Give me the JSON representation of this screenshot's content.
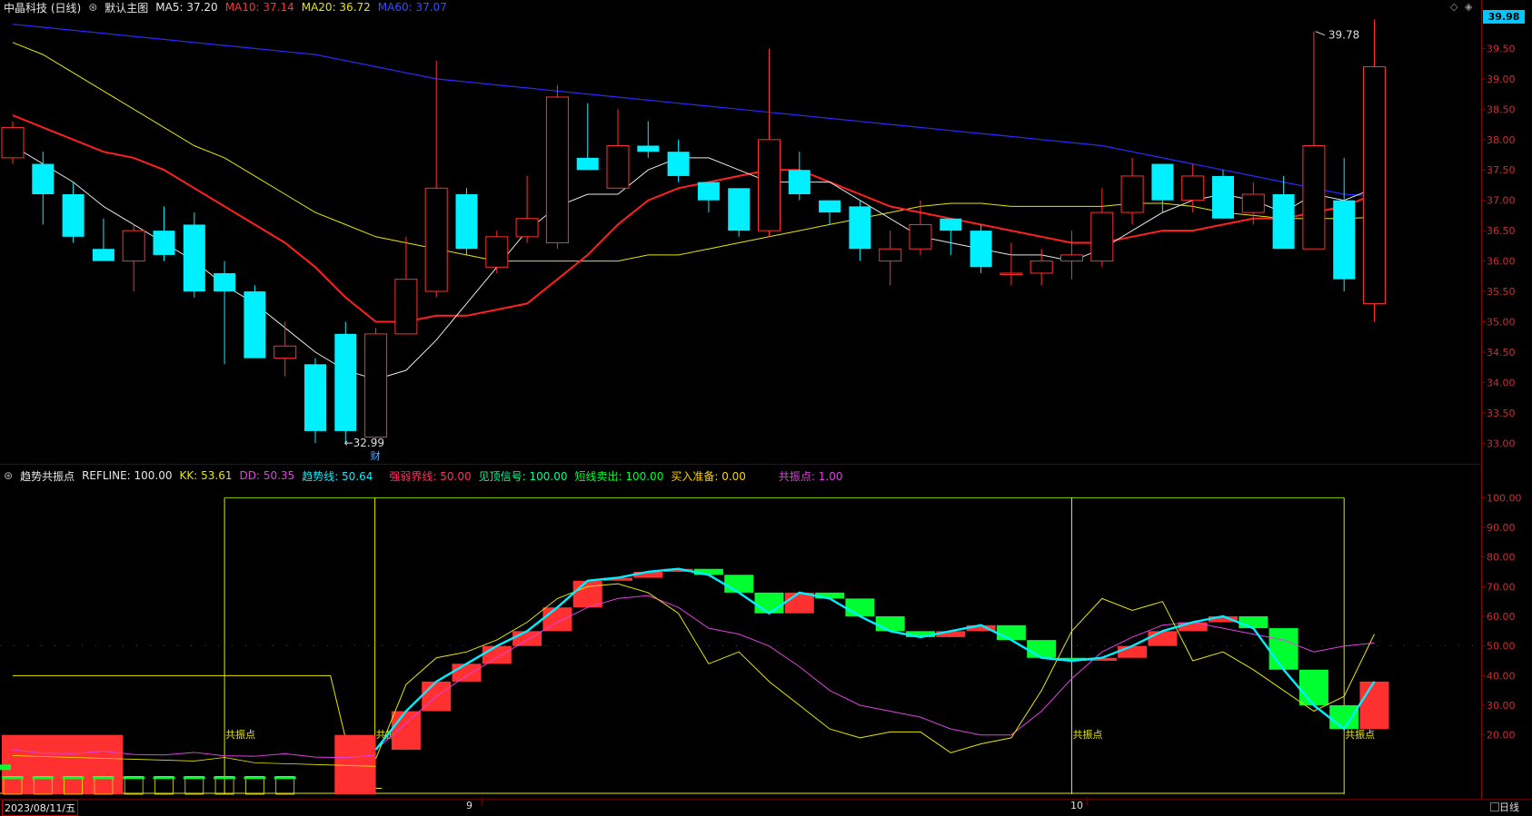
{
  "main": {
    "title": "中晶科技 (日线)",
    "template": "默认主图",
    "ma5_label": "MA5: 37.20",
    "ma10_label": "MA10: 37.14",
    "ma20_label": "MA20: 36.72",
    "ma60_label": "MA60: 37.07",
    "current_price": "39.98",
    "high_label": "39.78",
    "low_label": "32.99",
    "event_marker": "财",
    "axis_ticks": [
      "39.50",
      "39.00",
      "38.50",
      "38.00",
      "37.50",
      "37.00",
      "36.50",
      "36.00",
      "35.50",
      "35.00",
      "34.50",
      "34.00",
      "33.50",
      "33.00"
    ]
  },
  "indicator": {
    "name": "趋势共振点",
    "refline": "REFLINE: 100.00",
    "kk": "KK: 53.61",
    "dd": "DD: 50.35",
    "trend": "趋势线: 50.64",
    "strong_weak": "强弱界线: 50.00",
    "top_signal": "见顶信号: 100.00",
    "short_sell": "短线卖出: 100.00",
    "buy_ready": "买入准备: 0.00",
    "resonance": "共振点: 1.00",
    "resonance_tag": "共振点",
    "axis_ticks": [
      "100.00",
      "90.00",
      "80.00",
      "70.00",
      "60.00",
      "50.00",
      "40.00",
      "30.00",
      "20.00"
    ]
  },
  "timeline": {
    "start_date": "2023/08/11/五",
    "month_9": "9",
    "month_10": "10",
    "period_tab": "日线"
  },
  "colors": {
    "up": "#ff3030",
    "down": "#00f0ff",
    "ma5": "#e8e8e8",
    "ma10": "#ff2020",
    "ma20": "#e6e600",
    "ma60": "#2a2aff",
    "green_block": "#00ff30",
    "magenta": "#e040e0"
  },
  "chart_data": [
    {
      "type": "candlestick",
      "series_name": "中晶科技 (日线)",
      "ylim": [
        32.75,
        40.0
      ],
      "candles": [
        [
          37.7,
          38.2,
          38.3,
          37.6
        ],
        [
          37.6,
          37.1,
          37.8,
          36.6
        ],
        [
          37.1,
          36.4,
          37.3,
          36.3
        ],
        [
          36.2,
          36.0,
          36.7,
          36.0
        ],
        [
          36.0,
          36.5,
          36.6,
          35.5
        ],
        [
          36.5,
          36.1,
          36.9,
          36.0
        ],
        [
          36.6,
          35.5,
          36.8,
          35.4
        ],
        [
          35.8,
          35.5,
          36.0,
          34.3
        ],
        [
          35.5,
          34.4,
          35.6,
          34.4
        ],
        [
          34.4,
          34.6,
          35.0,
          34.1
        ],
        [
          34.3,
          33.2,
          34.4,
          33.0
        ],
        [
          34.8,
          33.2,
          35.0,
          33.0
        ],
        [
          33.1,
          34.8,
          34.9,
          32.99
        ],
        [
          34.8,
          35.7,
          36.4,
          34.8
        ],
        [
          35.5,
          37.2,
          39.3,
          35.4
        ],
        [
          37.1,
          36.2,
          37.2,
          36.1
        ],
        [
          35.9,
          36.4,
          36.5,
          35.8
        ],
        [
          36.4,
          36.7,
          37.4,
          36.3
        ],
        [
          36.3,
          38.7,
          38.9,
          36.2
        ],
        [
          37.7,
          37.5,
          38.6,
          37.5
        ],
        [
          37.2,
          37.9,
          38.5,
          37.2
        ],
        [
          37.9,
          37.8,
          38.3,
          37.7
        ],
        [
          37.8,
          37.4,
          38.0,
          37.3
        ],
        [
          37.3,
          37.0,
          37.3,
          36.8
        ],
        [
          37.2,
          36.5,
          37.2,
          36.4
        ],
        [
          36.5,
          38.0,
          39.5,
          36.4
        ],
        [
          37.5,
          37.1,
          37.8,
          37.0
        ],
        [
          37.0,
          36.8,
          37.0,
          36.6
        ],
        [
          36.9,
          36.2,
          37.0,
          36.0
        ],
        [
          36.0,
          36.2,
          36.5,
          35.6
        ],
        [
          36.2,
          36.6,
          37.0,
          36.1
        ],
        [
          36.7,
          36.5,
          36.7,
          36.1
        ],
        [
          36.5,
          35.9,
          36.6,
          35.8
        ],
        [
          35.8,
          35.8,
          36.3,
          35.6
        ],
        [
          35.8,
          36.0,
          36.2,
          35.6
        ],
        [
          36.0,
          36.1,
          36.5,
          35.7
        ],
        [
          36.0,
          36.8,
          37.2,
          35.9
        ],
        [
          36.8,
          37.4,
          37.7,
          36.6
        ],
        [
          37.6,
          37.0,
          37.6,
          36.8
        ],
        [
          37.0,
          37.4,
          37.6,
          36.8
        ],
        [
          37.4,
          36.7,
          37.5,
          36.7
        ],
        [
          36.8,
          37.1,
          37.3,
          36.6
        ],
        [
          37.1,
          36.2,
          37.4,
          36.2
        ],
        [
          36.2,
          37.9,
          39.78,
          36.2
        ],
        [
          37.0,
          35.7,
          37.7,
          35.5
        ],
        [
          35.3,
          39.2,
          39.98,
          35.0
        ]
      ],
      "ma5": [
        37.9,
        37.6,
        37.3,
        36.9,
        36.6,
        36.3,
        36.0,
        35.6,
        35.3,
        34.9,
        34.5,
        34.2,
        34.05,
        34.2,
        34.7,
        35.3,
        35.9,
        36.5,
        36.9,
        37.1,
        37.1,
        37.5,
        37.7,
        37.7,
        37.5,
        37.3,
        37.3,
        37.3,
        37.0,
        36.7,
        36.4,
        36.3,
        36.2,
        36.1,
        36.1,
        36.0,
        36.2,
        36.5,
        36.8,
        37.0,
        37.1,
        37.0,
        36.8,
        37.1,
        37.0,
        37.2
      ],
      "ma10": [
        38.4,
        38.2,
        38.0,
        37.8,
        37.7,
        37.5,
        37.2,
        36.9,
        36.6,
        36.3,
        35.9,
        35.4,
        35.0,
        35.0,
        35.1,
        35.1,
        35.2,
        35.3,
        35.7,
        36.1,
        36.6,
        37.0,
        37.2,
        37.3,
        37.4,
        37.5,
        37.5,
        37.3,
        37.1,
        36.9,
        36.8,
        36.7,
        36.6,
        36.5,
        36.4,
        36.3,
        36.3,
        36.4,
        36.5,
        36.5,
        36.6,
        36.7,
        36.7,
        36.8,
        36.9,
        37.1
      ],
      "ma20": [
        39.6,
        39.4,
        39.1,
        38.8,
        38.5,
        38.2,
        37.9,
        37.7,
        37.4,
        37.1,
        36.8,
        36.6,
        36.4,
        36.3,
        36.2,
        36.1,
        36.0,
        36.0,
        36.0,
        36.0,
        36.0,
        36.1,
        36.1,
        36.2,
        36.3,
        36.4,
        36.5,
        36.6,
        36.7,
        36.8,
        36.9,
        36.95,
        36.95,
        36.9,
        36.9,
        36.9,
        36.9,
        36.95,
        36.95,
        36.9,
        36.8,
        36.75,
        36.7,
        36.7,
        36.7,
        36.72
      ],
      "ma60": [
        39.9,
        39.85,
        39.8,
        39.75,
        39.7,
        39.65,
        39.6,
        39.55,
        39.5,
        39.45,
        39.4,
        39.3,
        39.2,
        39.1,
        39.0,
        38.95,
        38.9,
        38.85,
        38.8,
        38.75,
        38.7,
        38.65,
        38.6,
        38.55,
        38.5,
        38.45,
        38.4,
        38.35,
        38.3,
        38.25,
        38.2,
        38.15,
        38.1,
        38.05,
        38.0,
        37.95,
        37.9,
        37.8,
        37.7,
        37.6,
        37.5,
        37.4,
        37.3,
        37.2,
        37.1,
        37.07
      ]
    },
    {
      "type": "line",
      "series_name": "趋势共振点",
      "ylim": [
        0,
        105
      ],
      "trend": [
        null,
        null,
        null,
        null,
        null,
        null,
        null,
        null,
        null,
        null,
        null,
        null,
        15,
        28,
        38,
        44,
        50,
        55,
        63,
        72,
        73,
        75,
        76,
        74,
        68,
        61,
        68,
        66,
        60,
        55,
        53,
        55,
        57,
        52,
        46,
        45,
        46,
        50,
        55,
        58,
        60,
        56,
        42,
        30,
        22,
        38
      ],
      "kk": [
        null,
        null,
        null,
        null,
        null,
        null,
        null,
        null,
        null,
        null,
        null,
        null,
        12,
        37,
        46,
        48,
        52,
        58,
        66,
        70,
        71,
        68,
        61,
        44,
        48,
        38,
        30,
        22,
        19,
        21,
        21,
        14,
        17,
        19,
        35,
        55,
        66,
        62,
        65,
        45,
        48,
        42,
        35,
        28,
        33,
        54
      ],
      "dd": [
        null,
        null,
        null,
        null,
        null,
        null,
        null,
        null,
        null,
        null,
        null,
        null,
        15,
        24,
        33,
        40,
        46,
        52,
        58,
        63,
        66,
        67,
        63,
        56,
        54,
        50,
        43,
        35,
        30,
        28,
        26,
        22,
        20,
        20,
        28,
        39,
        48,
        53,
        57,
        58,
        56,
        54,
        52,
        48,
        50,
        51
      ],
      "refline_left": 40,
      "resonance_days": [
        7,
        12,
        35,
        44
      ]
    }
  ]
}
